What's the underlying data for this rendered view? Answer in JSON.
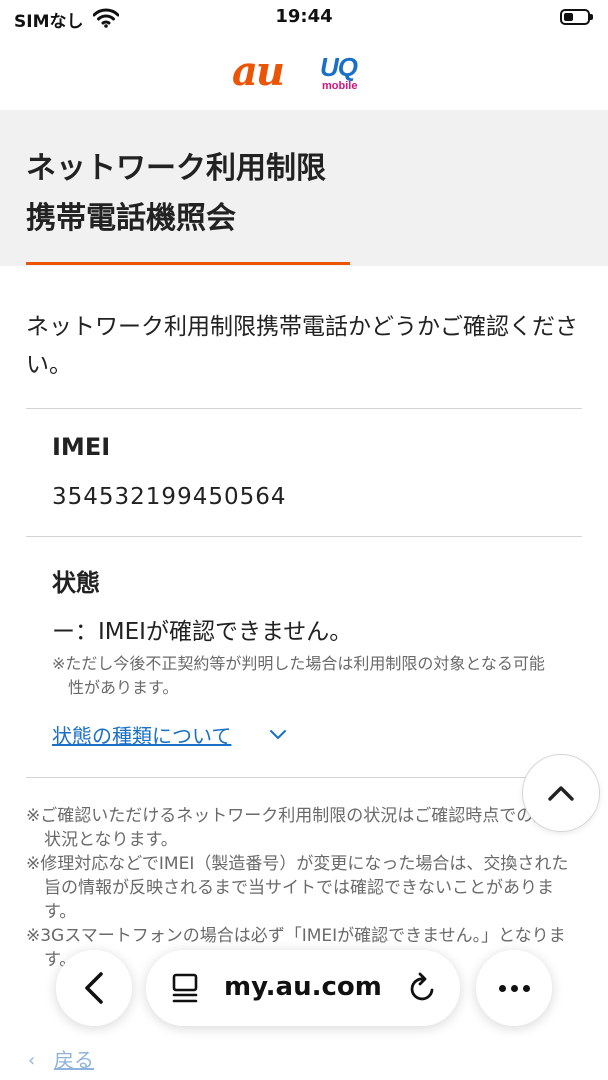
{
  "status_bar": {
    "carrier": "SIMなし",
    "time": "19:44"
  },
  "logos": {
    "au": "au",
    "uq": "UQ",
    "uq_sub": "mobile"
  },
  "page": {
    "title_line1": "ネットワーク利用制限",
    "title_line2": "携帯電話機照会",
    "intro": "ネットワーク利用制限携帯電話かどうかご確認ください。"
  },
  "imei": {
    "label": "IMEI",
    "value": "354532199450564"
  },
  "status": {
    "label": "状態",
    "value": "ー：IMEIが確認できません。",
    "note": "※ただし今後不正契約等が判明した場合は利用制限の対象となる可能性があります。",
    "link": "状態の種類について"
  },
  "footnotes": [
    "※ご確認いただけるネットワーク利用制限の状況はご確認時点での登録状況となります。",
    "※修理対応などでIMEI（製造番号）が変更になった場合は、交換された旨の情報が反映されるまで当サイトでは確認できないことがあります。",
    "※3Gスマートフォンの場合は必ず「IMEIが確認できません。」となります。"
  ],
  "back_link": "戻る",
  "browser": {
    "url": "my.au.com"
  },
  "colors": {
    "accent": "#eb5505",
    "link": "#1a70c5",
    "band": "#f1f1f1"
  }
}
